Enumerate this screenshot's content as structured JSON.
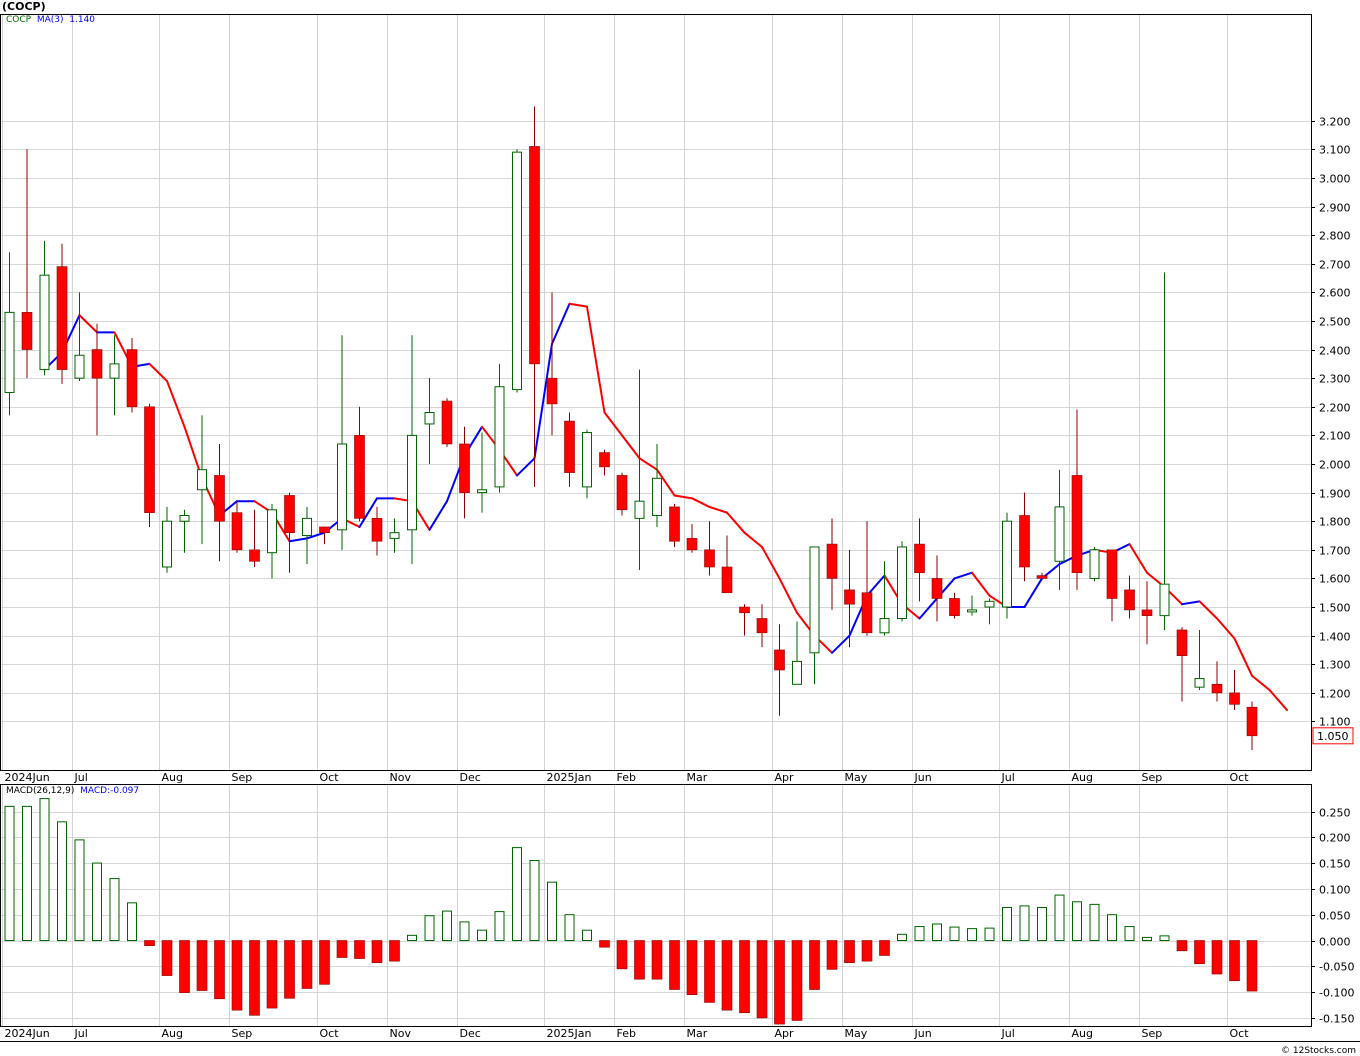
{
  "title": "(COCP)",
  "legend": {
    "symbol": "COCP",
    "ma_label": "MA(3)",
    "ma_value": "1.140",
    "macd_label": "MACD(26,12,9)",
    "macd_value_label": "MACD:-0.097"
  },
  "colors": {
    "up_candle": "#006400",
    "down_candle": "#ff0000",
    "ma_up": "#0000ff",
    "ma_down": "#ff0000",
    "grid": "#c8c8c8",
    "price_tag": "#ff0000"
  },
  "credit": "© 12Stocks.com",
  "last_price_label": "1.050",
  "chart_data": [
    {
      "type": "candlestick",
      "name": "price",
      "ylim": [
        1.0,
        3.26
      ],
      "yticks": [
        "1.100",
        "1.200",
        "1.300",
        "1.400",
        "1.500",
        "1.600",
        "1.700",
        "1.800",
        "1.900",
        "2.000",
        "2.100",
        "2.200",
        "2.300",
        "2.400",
        "2.500",
        "2.600",
        "2.700",
        "2.800",
        "2.900",
        "3.000",
        "3.100",
        "3.200"
      ],
      "month_labels": [
        {
          "label": "2024Jun",
          "week": 0
        },
        {
          "label": "Jul",
          "week": 4
        },
        {
          "label": "Aug",
          "week": 9
        },
        {
          "label": "Sep",
          "week": 13
        },
        {
          "label": "Oct",
          "week": 18
        },
        {
          "label": "Nov",
          "week": 22
        },
        {
          "label": "Dec",
          "week": 26
        },
        {
          "label": "2025Jan",
          "week": 31
        },
        {
          "label": "Feb",
          "week": 35
        },
        {
          "label": "Mar",
          "week": 39
        },
        {
          "label": "Apr",
          "week": 44
        },
        {
          "label": "May",
          "week": 48
        },
        {
          "label": "Jun",
          "week": 52
        },
        {
          "label": "Jul",
          "week": 57
        },
        {
          "label": "Aug",
          "week": 61
        },
        {
          "label": "Sep",
          "week": 65
        },
        {
          "label": "Oct",
          "week": 70
        }
      ],
      "candles": [
        {
          "o": 2.25,
          "h": 2.74,
          "l": 2.17,
          "c": 2.53
        },
        {
          "o": 2.53,
          "h": 3.1,
          "l": 2.3,
          "c": 2.4
        },
        {
          "o": 2.33,
          "h": 2.78,
          "l": 2.31,
          "c": 2.66
        },
        {
          "o": 2.69,
          "h": 2.77,
          "l": 2.28,
          "c": 2.33
        },
        {
          "o": 2.3,
          "h": 2.6,
          "l": 2.29,
          "c": 2.38
        },
        {
          "o": 2.4,
          "h": 2.49,
          "l": 2.1,
          "c": 2.3
        },
        {
          "o": 2.3,
          "h": 2.45,
          "l": 2.17,
          "c": 2.35
        },
        {
          "o": 2.4,
          "h": 2.44,
          "l": 2.18,
          "c": 2.2
        },
        {
          "o": 2.2,
          "h": 2.21,
          "l": 1.78,
          "c": 1.83
        },
        {
          "o": 1.64,
          "h": 1.85,
          "l": 1.62,
          "c": 1.8
        },
        {
          "o": 1.8,
          "h": 1.84,
          "l": 1.69,
          "c": 1.82
        },
        {
          "o": 1.91,
          "h": 2.17,
          "l": 1.72,
          "c": 1.98
        },
        {
          "o": 1.96,
          "h": 2.07,
          "l": 1.66,
          "c": 1.8
        },
        {
          "o": 1.83,
          "h": 1.87,
          "l": 1.69,
          "c": 1.7
        },
        {
          "o": 1.7,
          "h": 1.84,
          "l": 1.64,
          "c": 1.66
        },
        {
          "o": 1.69,
          "h": 1.86,
          "l": 1.6,
          "c": 1.84
        },
        {
          "o": 1.89,
          "h": 1.9,
          "l": 1.62,
          "c": 1.76
        },
        {
          "o": 1.75,
          "h": 1.85,
          "l": 1.65,
          "c": 1.81
        },
        {
          "o": 1.78,
          "h": 1.78,
          "l": 1.72,
          "c": 1.76
        },
        {
          "o": 1.77,
          "h": 2.45,
          "l": 1.7,
          "c": 2.07
        },
        {
          "o": 2.1,
          "h": 2.2,
          "l": 1.8,
          "c": 1.81
        },
        {
          "o": 1.81,
          "h": 1.85,
          "l": 1.68,
          "c": 1.73
        },
        {
          "o": 1.74,
          "h": 1.81,
          "l": 1.69,
          "c": 1.76
        },
        {
          "o": 1.77,
          "h": 2.45,
          "l": 1.65,
          "c": 2.1
        },
        {
          "o": 2.14,
          "h": 2.3,
          "l": 2.0,
          "c": 2.18
        },
        {
          "o": 2.22,
          "h": 2.23,
          "l": 2.06,
          "c": 2.07
        },
        {
          "o": 2.07,
          "h": 2.13,
          "l": 1.81,
          "c": 1.9
        },
        {
          "o": 1.9,
          "h": 2.11,
          "l": 1.83,
          "c": 1.91
        },
        {
          "o": 1.92,
          "h": 2.35,
          "l": 1.9,
          "c": 2.27
        },
        {
          "o": 2.26,
          "h": 3.1,
          "l": 2.25,
          "c": 3.09
        },
        {
          "o": 3.11,
          "h": 3.25,
          "l": 1.92,
          "c": 2.35
        },
        {
          "o": 2.3,
          "h": 2.6,
          "l": 2.1,
          "c": 2.21
        },
        {
          "o": 2.15,
          "h": 2.18,
          "l": 1.92,
          "c": 1.97
        },
        {
          "o": 1.92,
          "h": 2.12,
          "l": 1.88,
          "c": 2.11
        },
        {
          "o": 2.04,
          "h": 2.05,
          "l": 1.96,
          "c": 1.99
        },
        {
          "o": 1.96,
          "h": 1.97,
          "l": 1.82,
          "c": 1.84
        },
        {
          "o": 1.81,
          "h": 2.33,
          "l": 1.63,
          "c": 1.87
        },
        {
          "o": 1.82,
          "h": 2.07,
          "l": 1.78,
          "c": 1.95
        },
        {
          "o": 1.85,
          "h": 1.86,
          "l": 1.71,
          "c": 1.73
        },
        {
          "o": 1.74,
          "h": 1.79,
          "l": 1.69,
          "c": 1.7
        },
        {
          "o": 1.7,
          "h": 1.8,
          "l": 1.61,
          "c": 1.64
        },
        {
          "o": 1.64,
          "h": 1.75,
          "l": 1.55,
          "c": 1.55
        },
        {
          "o": 1.5,
          "h": 1.51,
          "l": 1.4,
          "c": 1.48
        },
        {
          "o": 1.46,
          "h": 1.51,
          "l": 1.36,
          "c": 1.41
        },
        {
          "o": 1.35,
          "h": 1.44,
          "l": 1.12,
          "c": 1.28
        },
        {
          "o": 1.23,
          "h": 1.45,
          "l": 1.23,
          "c": 1.31
        },
        {
          "o": 1.34,
          "h": 1.71,
          "l": 1.23,
          "c": 1.71
        },
        {
          "o": 1.72,
          "h": 1.81,
          "l": 1.49,
          "c": 1.6
        },
        {
          "o": 1.56,
          "h": 1.7,
          "l": 1.36,
          "c": 1.51
        },
        {
          "o": 1.55,
          "h": 1.8,
          "l": 1.4,
          "c": 1.41
        },
        {
          "o": 1.41,
          "h": 1.66,
          "l": 1.4,
          "c": 1.46
        },
        {
          "o": 1.46,
          "h": 1.73,
          "l": 1.45,
          "c": 1.71
        },
        {
          "o": 1.72,
          "h": 1.81,
          "l": 1.52,
          "c": 1.62
        },
        {
          "o": 1.6,
          "h": 1.68,
          "l": 1.45,
          "c": 1.53
        },
        {
          "o": 1.53,
          "h": 1.55,
          "l": 1.46,
          "c": 1.47
        },
        {
          "o": 1.49,
          "h": 1.54,
          "l": 1.47,
          "c": 1.49
        },
        {
          "o": 1.5,
          "h": 1.53,
          "l": 1.44,
          "c": 1.52
        },
        {
          "o": 1.5,
          "h": 1.83,
          "l": 1.46,
          "c": 1.8
        },
        {
          "o": 1.82,
          "h": 1.9,
          "l": 1.59,
          "c": 1.64
        },
        {
          "o": 1.61,
          "h": 1.62,
          "l": 1.6,
          "c": 1.6
        },
        {
          "o": 1.66,
          "h": 1.98,
          "l": 1.56,
          "c": 1.85
        },
        {
          "o": 1.96,
          "h": 2.19,
          "l": 1.56,
          "c": 1.62
        },
        {
          "o": 1.6,
          "h": 1.71,
          "l": 1.59,
          "c": 1.7
        },
        {
          "o": 1.7,
          "h": 1.7,
          "l": 1.45,
          "c": 1.53
        },
        {
          "o": 1.56,
          "h": 1.61,
          "l": 1.46,
          "c": 1.49
        },
        {
          "o": 1.49,
          "h": 1.59,
          "l": 1.37,
          "c": 1.47
        },
        {
          "o": 1.47,
          "h": 2.67,
          "l": 1.42,
          "c": 1.58
        },
        {
          "o": 1.42,
          "h": 1.43,
          "l": 1.17,
          "c": 1.33
        },
        {
          "o": 1.22,
          "h": 1.42,
          "l": 1.21,
          "c": 1.25
        },
        {
          "o": 1.23,
          "h": 1.31,
          "l": 1.17,
          "c": 1.2
        },
        {
          "o": 1.2,
          "h": 1.28,
          "l": 1.14,
          "c": 1.16
        },
        {
          "o": 1.15,
          "h": 1.17,
          "l": 1.0,
          "c": 1.05
        }
      ],
      "ma3": [
        2.33,
        2.39,
        2.52,
        2.46,
        2.46,
        2.34,
        2.35,
        2.29,
        2.13,
        1.95,
        1.82,
        1.87,
        1.87,
        1.83,
        1.73,
        1.74,
        1.76,
        1.81,
        1.78,
        1.88,
        1.88,
        1.87,
        1.77,
        1.87,
        2.03,
        2.13,
        2.05,
        1.96,
        2.02,
        2.42,
        2.56,
        2.55,
        2.18,
        2.1,
        2.02,
        1.98,
        1.89,
        1.88,
        1.85,
        1.83,
        1.76,
        1.71,
        1.6,
        1.48,
        1.4,
        1.34,
        1.4,
        1.54,
        1.61,
        1.51,
        1.46,
        1.53,
        1.6,
        1.62,
        1.54,
        1.5,
        1.5,
        1.6,
        1.65,
        1.68,
        1.7,
        1.69,
        1.72,
        1.62,
        1.57,
        1.51,
        1.52,
        1.46,
        1.39,
        1.26,
        1.21,
        1.14
      ]
    },
    {
      "type": "bar",
      "name": "MACD(26,12,9)",
      "ylim": [
        -0.165,
        0.27
      ],
      "yticks": [
        "0.250",
        "0.200",
        "0.150",
        "0.100",
        "0.050",
        "0.000",
        "-0.050",
        "-0.100",
        "-0.150"
      ],
      "values": [
        0.26,
        0.26,
        0.275,
        0.23,
        0.195,
        0.15,
        0.12,
        0.073,
        -0.01,
        -0.068,
        -0.101,
        -0.097,
        -0.113,
        -0.135,
        -0.145,
        -0.131,
        -0.112,
        -0.093,
        -0.085,
        -0.033,
        -0.035,
        -0.043,
        -0.04,
        0.01,
        0.048,
        0.057,
        0.036,
        0.02,
        0.056,
        0.18,
        0.155,
        0.113,
        0.05,
        0.02,
        -0.013,
        -0.055,
        -0.075,
        -0.075,
        -0.095,
        -0.105,
        -0.12,
        -0.135,
        -0.14,
        -0.15,
        -0.162,
        -0.155,
        -0.095,
        -0.056,
        -0.043,
        -0.04,
        -0.029,
        0.012,
        0.027,
        0.032,
        0.026,
        0.023,
        0.024,
        0.064,
        0.067,
        0.064,
        0.088,
        0.075,
        0.07,
        0.05,
        0.027,
        0.006,
        0.009,
        -0.02,
        -0.045,
        -0.065,
        -0.078,
        -0.098
      ]
    }
  ]
}
